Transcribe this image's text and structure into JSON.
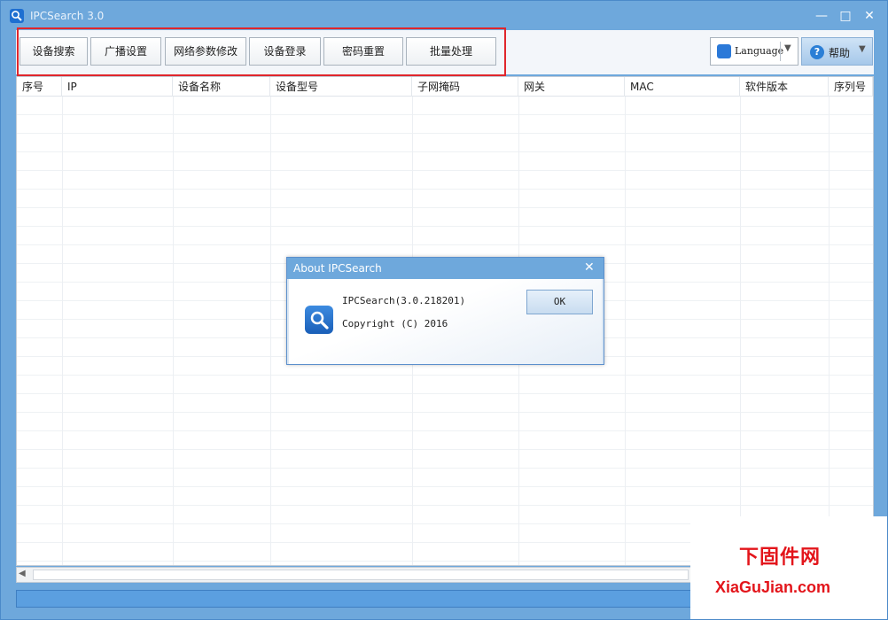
{
  "window": {
    "title": "IPCSearch 3.0"
  },
  "titlebar_buttons": {
    "minimize": "—",
    "maximize": "□",
    "close": "✕"
  },
  "toolbar": {
    "buttons": [
      "设备搜索",
      "广播设置",
      "网络参数修改",
      "设备登录",
      "密码重置",
      "批量处理"
    ]
  },
  "language": {
    "label": "Language"
  },
  "help": {
    "label": "帮助"
  },
  "table": {
    "columns": [
      "序号",
      "IP",
      "设备名称",
      "设备型号",
      "子网掩码",
      "网关",
      "MAC",
      "软件版本",
      "序列号"
    ]
  },
  "dialog": {
    "title": "About IPCSearch",
    "close": "✕",
    "product_line": "IPCSearch(3.0.218201)",
    "copyright_line": "Copyright (C) 2016",
    "ok_label": "OK"
  },
  "watermark": {
    "cn": "下固件网",
    "en": "XiaGuJian.com"
  },
  "colors": {
    "titlebar": "#6ea8dc",
    "highlight": "#e0262c",
    "watermark": "#e3151b"
  }
}
